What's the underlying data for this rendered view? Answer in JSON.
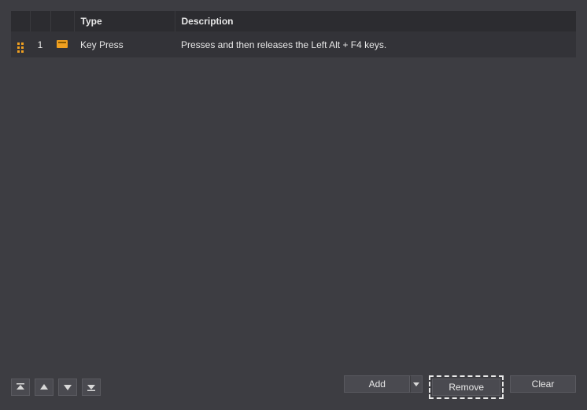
{
  "table": {
    "headers": {
      "type": "Type",
      "description": "Description"
    },
    "rows": [
      {
        "num": "1",
        "type": "Key Press",
        "description": "Presses and then releases the Left Alt + F4 keys."
      }
    ]
  },
  "footer": {
    "add_label": "Add",
    "remove_label": "Remove",
    "clear_label": "Clear"
  }
}
